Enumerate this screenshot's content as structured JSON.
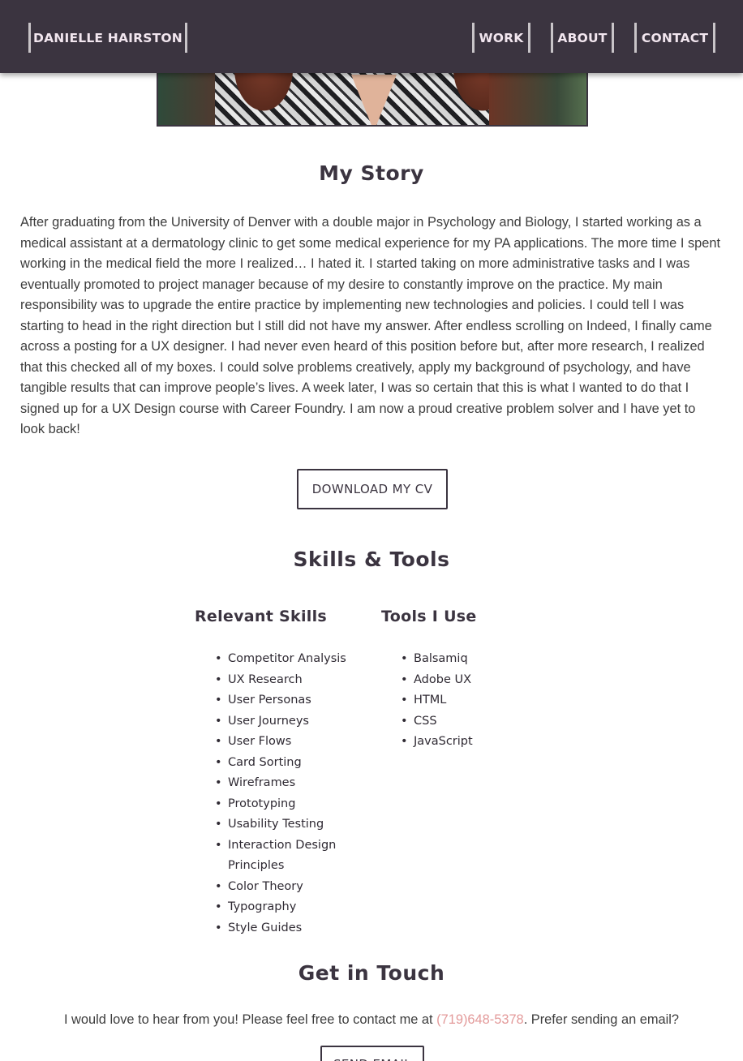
{
  "header": {
    "brand": "DANIELLE HAIRSTON",
    "nav": {
      "work": "WORK",
      "about": "ABOUT",
      "contact": "CONTACT"
    }
  },
  "story": {
    "title": "My Story",
    "body": "After graduating from the University of Denver with a double major in Psychology and Biology, I started working as a medical assistant at a dermatology clinic to get some medical experience for my PA applications. The more time I spent working in the medical field the more I realized… I hated it. I started taking on more administrative tasks and I was eventually promoted to project manager because of my desire to constantly improve on the practice. My main responsibility was to upgrade the entire practice by implementing new technologies and policies. I could tell I was starting to head in the right direction but I still did not have my answer. After endless scrolling on Indeed, I finally came across a posting for a UX designer. I had never even heard of this position before but, after more research, I realized that this checked all of my boxes. I could solve problems creatively, apply my background of psychology, and have tangible results that can improve people’s lives. A week later, I was so certain that this is what I wanted to do that I signed up for a UX Design course with Career Foundry. I am now a proud creative problem solver and I have yet to look back!",
    "cv_button": "DOWNLOAD MY CV"
  },
  "skills_tools": {
    "title": "Skills & Tools",
    "skills": {
      "heading": "Relevant Skills",
      "items": [
        "Competitor Analysis",
        "UX Research",
        "User Personas",
        "User Journeys",
        "User Flows",
        "Card Sorting",
        "Wireframes",
        "Prototyping",
        "Usability Testing",
        "Interaction Design Principles",
        "Color Theory",
        "Typography",
        "Style Guides"
      ]
    },
    "tools": {
      "heading": "Tools I Use",
      "items": [
        "Balsamiq",
        "Adobe UX",
        "HTML",
        "CSS",
        "JavaScript"
      ]
    }
  },
  "contact": {
    "title": "Get in Touch",
    "text_before": "I would love to hear from you! Please feel free to contact me at ",
    "phone": "(719)648-5378",
    "text_after": ". Prefer sending an email?",
    "email_button": "SEND EMAIL"
  },
  "colors": {
    "header_bg": "#3b3440",
    "nav_text": "#f2e6ef",
    "accent_link": "#e39a9a"
  }
}
